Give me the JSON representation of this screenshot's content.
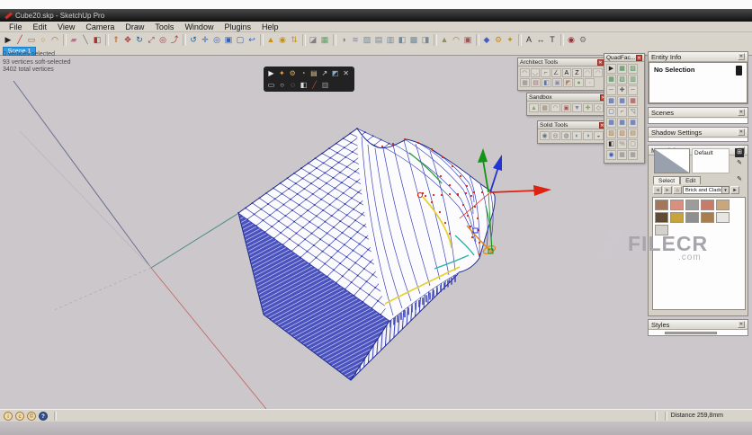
{
  "window": {
    "title": "Cube20.skp - SketchUp Pro"
  },
  "menu": {
    "items": [
      "File",
      "Edit",
      "View",
      "Camera",
      "Draw",
      "Tools",
      "Window",
      "Plugins",
      "Help"
    ]
  },
  "toolbar": {
    "icons": [
      [
        "select",
        "▶",
        "#222222",
        false
      ],
      [
        "line",
        "╱",
        "#b03030",
        false
      ],
      [
        "rectangle",
        "▭",
        "#96642a",
        false
      ],
      [
        "circle",
        "○",
        "#c89010",
        false
      ],
      [
        "arc",
        "◠",
        "#96642a",
        false
      ],
      [
        "eraser",
        "▰",
        "#c07090",
        true
      ],
      [
        "tape-measure",
        "╲",
        "#707070",
        false
      ],
      [
        "paint-bucket",
        "◧",
        "#b03030",
        false
      ],
      [
        "push-pull",
        "⇑",
        "#c06010",
        true
      ],
      [
        "move",
        "✥",
        "#b03030",
        false
      ],
      [
        "rotate",
        "↻",
        "#1060a0",
        false
      ],
      [
        "scale",
        "⤢",
        "#b03030",
        false
      ],
      [
        "offset",
        "◎",
        "#b03030",
        false
      ],
      [
        "follow-me",
        "⤴",
        "#b03030",
        false
      ],
      [
        "orbit",
        "↺",
        "#1060a0",
        true
      ],
      [
        "pan",
        "✛",
        "#3060c0",
        false
      ],
      [
        "zoom",
        "◎",
        "#3060c0",
        false
      ],
      [
        "zoom-window",
        "▣",
        "#3060c0",
        false
      ],
      [
        "zoom-extents",
        "▢",
        "#3060c0",
        false
      ],
      [
        "previous-view",
        "↩",
        "#3060c0",
        false
      ],
      [
        "position-camera",
        "▲",
        "#c89010",
        true
      ],
      [
        "look-around",
        "◉",
        "#c89010",
        false
      ],
      [
        "walk",
        "⇅",
        "#c89010",
        false
      ],
      [
        "section-plane",
        "◪",
        "#808080",
        true
      ],
      [
        "add-scene",
        "▦",
        "#60a060",
        false
      ],
      [
        "shadows",
        "◑",
        "#888060",
        true
      ],
      [
        "fog",
        "≋",
        "#8888a8",
        false
      ],
      [
        "x-ray",
        "▨",
        "#708898",
        false
      ],
      [
        "wireframe",
        "▤",
        "#708898",
        false
      ],
      [
        "hidden-line",
        "▥",
        "#708898",
        false
      ],
      [
        "shaded",
        "◧",
        "#708898",
        false
      ],
      [
        "textured",
        "▩",
        "#708898",
        false
      ],
      [
        "monochrome",
        "◨",
        "#708898",
        false
      ],
      [
        "from-contours",
        "▲",
        "#88906a",
        true
      ],
      [
        "smoove",
        "◠",
        "#a0702a",
        false
      ],
      [
        "stamp",
        "▣",
        "#a05050",
        false
      ],
      [
        "make-component",
        "◆",
        "#4060c0",
        true
      ],
      [
        "dynamic-components",
        "⚙",
        "#c89010",
        false
      ],
      [
        "interact",
        "✦",
        "#c89010",
        false
      ],
      [
        "text",
        "A",
        "#303030",
        true
      ],
      [
        "dimensions",
        "↔",
        "#303030",
        false
      ],
      [
        "3d-text",
        "T",
        "#303030",
        false
      ],
      [
        "extension-warehouse",
        "◉",
        "#a03030",
        true
      ],
      [
        "preferences",
        "⚙",
        "#707070",
        false
      ]
    ]
  },
  "scene_tab": {
    "label": "Scene 1"
  },
  "viewport": {
    "stats_line1": "0 vertices selected",
    "stats_line2": "93 vertices soft-selected",
    "stats_line3": "3402 total vertices"
  },
  "vertex_toolbar": {
    "rows": [
      [
        [
          "vertex-select",
          "▶",
          "#eeeeee"
        ],
        [
          "vertex-gizmo",
          "✦",
          "#e9a33a"
        ],
        [
          "vertex-settings",
          "⚙",
          "#e9a33a"
        ],
        [
          "vertex-soft-radius",
          "◔",
          "#e9a33a"
        ],
        [
          "vertex-modes",
          "▤",
          "#d8c090"
        ],
        [
          "vertex-extrude",
          "↗",
          "#dddddd"
        ],
        [
          "vertex-merge",
          "◩",
          "#88aacc"
        ],
        [
          "vertex-close",
          "✕",
          "#cccccc"
        ]
      ],
      [
        [
          "select-rect",
          "▭",
          "#dddddd"
        ],
        [
          "select-circle",
          "○",
          "#dddddd"
        ],
        [
          "select-lasso",
          "◌",
          "#dddddd"
        ],
        [
          "select-paint",
          "◧",
          "#dddddd"
        ],
        [
          "vertex-erase",
          "╱",
          "#d04030"
        ],
        [
          "vertex-grid",
          "▥",
          "#999999"
        ]
      ]
    ]
  },
  "plugin_windows": {
    "architect": {
      "title": "Architect Tools",
      "rows": [
        [
          [
            "road",
            "◠",
            "#787878"
          ],
          [
            "curb",
            "◡",
            "#787878"
          ],
          [
            "stair",
            "⌐",
            "#585858"
          ],
          [
            "ramp",
            "∠",
            "#585858"
          ],
          [
            "label-a",
            "A",
            "#111111"
          ],
          [
            "label-z",
            "Z",
            "#111111"
          ],
          [
            "arc-wall",
            "◠",
            "#989898"
          ],
          [
            "arc-fence",
            "◠",
            "#989898"
          ]
        ],
        [
          [
            "grid-tool",
            "▦",
            "#888888"
          ],
          [
            "brick-tool",
            "▤",
            "#aa6666"
          ],
          [
            "door-tool",
            "◧",
            "#5577aa"
          ],
          [
            "window-tool",
            "▣",
            "#8888aa"
          ],
          [
            "roof-tool",
            "◩",
            "#aa8866"
          ],
          [
            "tree-tool",
            "●",
            "#66aa66"
          ],
          [
            "misc-tool",
            "◦",
            "#999999"
          ]
        ]
      ]
    },
    "sandbox": {
      "title": "Sandbox",
      "rows": [
        [
          [
            "from-contours",
            "▲",
            "#88a070"
          ],
          [
            "from-scratch",
            "▦",
            "#998877"
          ],
          [
            "smoove",
            "◠",
            "#aa7760"
          ],
          [
            "stamp",
            "▣",
            "#aa5555"
          ],
          [
            "drape",
            "▼",
            "#7788aa"
          ],
          [
            "add-detail",
            "✚",
            "#88aa55"
          ],
          [
            "flip-edge",
            "◇",
            "#996677"
          ]
        ]
      ]
    },
    "solid_tools": {
      "title": "Solid Tools",
      "rows": [
        [
          [
            "outer-shell",
            "◉",
            "#667788"
          ],
          [
            "intersect",
            "◎",
            "#667788"
          ],
          [
            "union",
            "◍",
            "#667788"
          ],
          [
            "subtract",
            "◐",
            "#667788"
          ],
          [
            "trim",
            "◑",
            "#667788"
          ],
          [
            "split",
            "◒",
            "#667788"
          ]
        ]
      ]
    },
    "quadface": {
      "title": "QuadFac...",
      "rows": [
        [
          [
            "qf-select",
            "▶",
            "#222222"
          ],
          [
            "qf-grow",
            "▦",
            "#3a8a4a"
          ],
          [
            "qf-edit",
            "▨",
            "#3a8a4a"
          ]
        ],
        [
          [
            "qf-grow-loop",
            "▦",
            "#3a8a4a"
          ],
          [
            "qf-shrink-loop",
            "▧",
            "#3a8a4a"
          ],
          [
            "qf-ring",
            "▥",
            "#3a8a4a"
          ]
        ],
        [
          [
            "qf-deselect",
            "─",
            "#666666"
          ],
          [
            "qf-more",
            "✚",
            "#666666"
          ],
          [
            "qf-less",
            "╌",
            "#666666"
          ]
        ],
        [
          [
            "qf-connect",
            "▩",
            "#3a5ac0"
          ],
          [
            "qf-insert-loop",
            "▦",
            "#3a5ac0"
          ],
          [
            "qf-remove-loop",
            "▦",
            "#b03a3a"
          ]
        ],
        [
          [
            "qf-build-corners",
            "▢",
            "#3a5ac0"
          ],
          [
            "qf-flip-edge",
            "⌐",
            "#666666"
          ],
          [
            "qf-triangulate",
            "◹",
            "#666666"
          ]
        ],
        [
          [
            "qf-smooth",
            "▦",
            "#3a5ac0"
          ],
          [
            "qf-unsmooth",
            "▦",
            "#3a5ac0"
          ],
          [
            "qf-quadrangulate",
            "▦",
            "#3a5ac0"
          ]
        ],
        [
          [
            "qf-uv-map",
            "▨",
            "#a8793a"
          ],
          [
            "qf-uv-copy",
            "▧",
            "#a8793a"
          ],
          [
            "qf-uv-paste",
            "▤",
            "#a8793a"
          ]
        ],
        [
          [
            "qf-mirror",
            "◧",
            "#222222"
          ],
          [
            "qf-percent",
            "%",
            "#888888"
          ],
          [
            "qf-info",
            "▢",
            "#888888"
          ]
        ],
        [
          [
            "qf-manual",
            "◉",
            "#3a5ac0"
          ],
          [
            "qf-grid-a",
            "▦",
            "#888888"
          ],
          [
            "qf-grid-b",
            "▦",
            "#888888"
          ]
        ]
      ]
    }
  },
  "right_panel": {
    "entity_info": {
      "title": "Entity Info",
      "message": "No Selection"
    },
    "scenes": {
      "title": "Scenes"
    },
    "shadow_settings": {
      "title": "Shadow Settings"
    },
    "materials": {
      "title": "Materials",
      "preview_label": "Default",
      "tab_select": "Select",
      "tab_edit": "Edit",
      "collection": "Brick and Cladding",
      "swatches": [
        "#a4765a",
        "#d88f80",
        "#9c9c9c",
        "#c57d6b",
        "#c9a67c",
        "#5f4a33",
        "#c8a23a",
        "#8f8f8f",
        "#a87e4e",
        "#e7e6e2",
        "#d3d2cd"
      ]
    },
    "styles": {
      "title": "Styles"
    }
  },
  "status_bar": {
    "left_icons": [
      [
        "model-info",
        "i"
      ],
      [
        "credits",
        "c"
      ],
      [
        "claim",
        "©"
      ],
      [
        "help",
        "?"
      ]
    ],
    "distance_label": "Distance",
    "distance_value": "259,8mm"
  },
  "watermark": {
    "text": "FILECR",
    "suffix": ".com"
  },
  "colors": {
    "mesh_blue": "#3b43b8",
    "mesh_dot": "#272fa0",
    "mesh_dark": "#1f2a8e",
    "axis_red": "#c46a6a",
    "axis_green": "#4e8d80",
    "axis_blue": "#6b7094",
    "gizmo_red": "#dd2211",
    "gizmo_green": "#149414",
    "gizmo_blue": "#2334d0",
    "soft_yellow": "#e5d22e",
    "soft_orange": "#e08a20",
    "soft_green": "#2f9e44",
    "soft_teal": "#2bb3a3"
  }
}
